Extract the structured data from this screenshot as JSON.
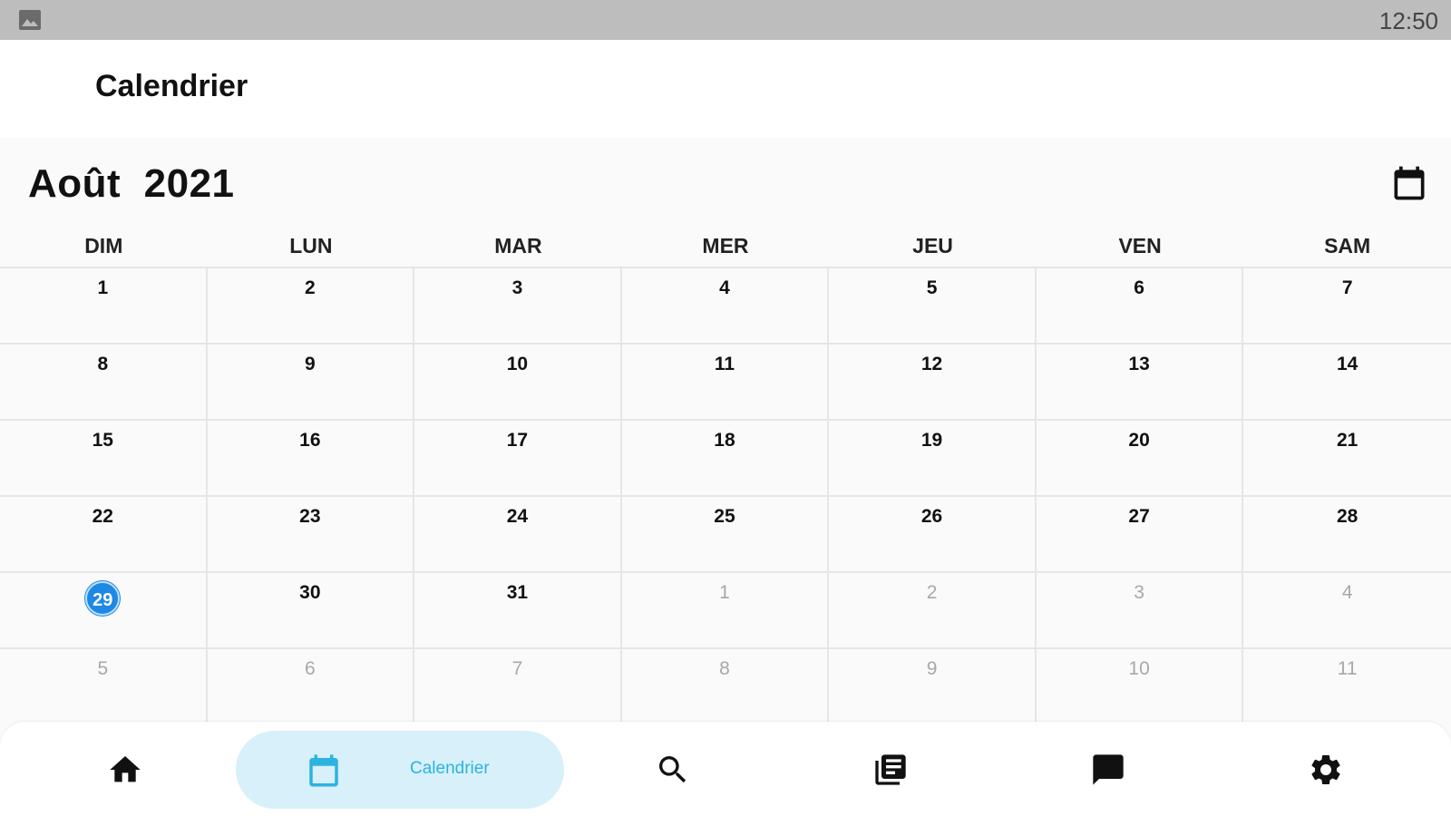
{
  "status_bar": {
    "time": "12:50",
    "icon": "image-icon"
  },
  "app_bar": {
    "title": "Calendrier"
  },
  "calendar": {
    "month_title": "Août  2021",
    "picker_icon": "calendar-icon",
    "weekdays": [
      "DIM",
      "LUN",
      "MAR",
      "MER",
      "JEU",
      "VEN",
      "SAM"
    ],
    "weeks": [
      [
        {
          "d": "1"
        },
        {
          "d": "2"
        },
        {
          "d": "3"
        },
        {
          "d": "4"
        },
        {
          "d": "5"
        },
        {
          "d": "6"
        },
        {
          "d": "7"
        }
      ],
      [
        {
          "d": "8"
        },
        {
          "d": "9"
        },
        {
          "d": "10"
        },
        {
          "d": "11"
        },
        {
          "d": "12"
        },
        {
          "d": "13"
        },
        {
          "d": "14"
        }
      ],
      [
        {
          "d": "15"
        },
        {
          "d": "16"
        },
        {
          "d": "17"
        },
        {
          "d": "18"
        },
        {
          "d": "19"
        },
        {
          "d": "20"
        },
        {
          "d": "21"
        }
      ],
      [
        {
          "d": "22"
        },
        {
          "d": "23"
        },
        {
          "d": "24"
        },
        {
          "d": "25"
        },
        {
          "d": "26"
        },
        {
          "d": "27"
        },
        {
          "d": "28"
        }
      ],
      [
        {
          "d": "29",
          "today": true
        },
        {
          "d": "30"
        },
        {
          "d": "31"
        },
        {
          "d": "1",
          "other": true
        },
        {
          "d": "2",
          "other": true
        },
        {
          "d": "3",
          "other": true
        },
        {
          "d": "4",
          "other": true
        }
      ],
      [
        {
          "d": "5",
          "other": true
        },
        {
          "d": "6",
          "other": true
        },
        {
          "d": "7",
          "other": true
        },
        {
          "d": "8",
          "other": true
        },
        {
          "d": "9",
          "other": true
        },
        {
          "d": "10",
          "other": true
        },
        {
          "d": "11",
          "other": true
        }
      ]
    ],
    "today_color": "#1e88e5",
    "other_month_color": "#a8a8a8"
  },
  "bottom_nav": {
    "items": [
      {
        "icon": "home-icon"
      },
      {
        "icon": "calendar-icon",
        "label": "Calendrier",
        "active": true
      },
      {
        "icon": "search-icon"
      },
      {
        "icon": "library-icon"
      },
      {
        "icon": "chat-icon"
      },
      {
        "icon": "settings-icon"
      }
    ],
    "active_bg": "#d7f0fa",
    "active_color": "#2cb3e0"
  }
}
